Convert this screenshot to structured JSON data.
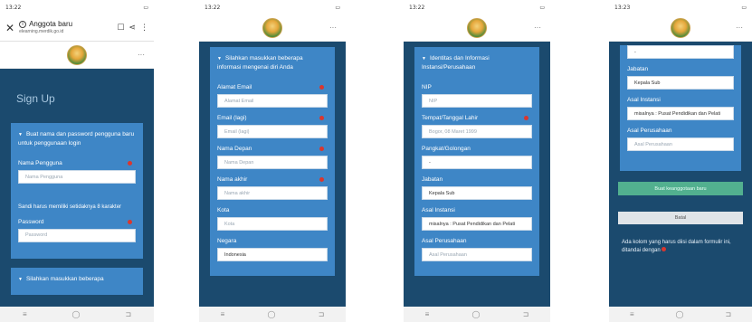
{
  "screen1": {
    "status_time": "13:22",
    "browser_title": "Anggota baru",
    "browser_url": "elearning.merdik.go.id",
    "page_title": "Sign Up",
    "section1_head": "Buat nama dan password pengguna baru untuk penggunaan login",
    "username_label": "Nama Pengguna",
    "username_placeholder": "Nama Pengguna",
    "password_note": "Sandi harus memiliki setidaknya 8 karakter",
    "password_label": "Password",
    "password_placeholder": "Password",
    "section2_head": "Silahkan masukkan beberapa"
  },
  "screen2": {
    "status_time": "13:22",
    "section_head": "Silahkan masukkan beberapa informasi mengenai diri Anda",
    "fields": [
      {
        "label": "Alamat Email",
        "placeholder": "Alamat Email",
        "required": true
      },
      {
        "label": "Email (lagi)",
        "placeholder": "Email (lagi)",
        "required": true
      },
      {
        "label": "Nama Depan",
        "placeholder": "Nama Depan",
        "required": true
      },
      {
        "label": "Nama akhir",
        "placeholder": "Nama akhir",
        "required": true
      },
      {
        "label": "Kota",
        "placeholder": "Kota",
        "required": false
      },
      {
        "label": "Negara",
        "value": "Indonesia",
        "required": false
      }
    ]
  },
  "screen3": {
    "status_time": "13:22",
    "section_head": "Identitas dan Informasi Instansi/Perusahaan",
    "fields": [
      {
        "label": "NIP",
        "placeholder": "NIP",
        "required": false
      },
      {
        "label": "Tempat/Tanggal Lahir",
        "placeholder": "Bogor, 08 Maret 1999",
        "required": true
      },
      {
        "label": "Pangkat/Golongan",
        "value": "-",
        "required": false
      },
      {
        "label": "Jabatan",
        "value": "Kepala Sub",
        "required": false
      },
      {
        "label": "Asal Instansi",
        "value": "misalnya : Pusat Pendidikan dan Pelati",
        "required": false
      },
      {
        "label": "Asal Perusahaan",
        "placeholder": "Asal Perusahaan",
        "required": false
      }
    ]
  },
  "screen4": {
    "status_time": "13:23",
    "top_value": "-",
    "fields": [
      {
        "label": "Jabatan",
        "value": "Kepala Sub"
      },
      {
        "label": "Asal Instansi",
        "value": "misalnya : Pusat Pendidikan dan Pelati"
      },
      {
        "label": "Asal Perusahaan",
        "placeholder": "Asal Perusahaan"
      }
    ],
    "create_button": "Buat keanggotaan baru",
    "cancel_button": "Batal",
    "footnote": "Ada kolom yang harus diisi dalam formulir ini, ditandai dengan"
  }
}
